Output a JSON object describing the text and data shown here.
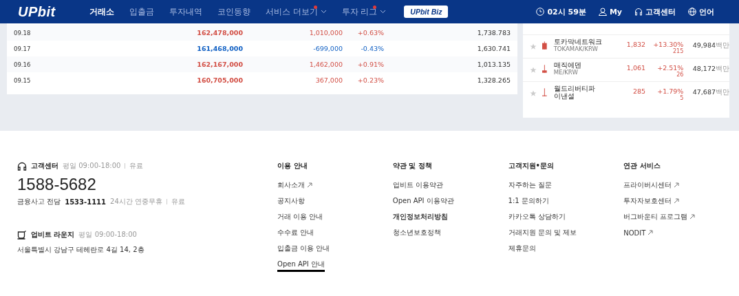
{
  "header": {
    "logo": "UPbit",
    "nav": [
      {
        "label": "거래소",
        "selected": true,
        "new": false,
        "dropdown": false
      },
      {
        "label": "입출금",
        "selected": false,
        "new": false,
        "dropdown": false
      },
      {
        "label": "투자내역",
        "selected": false,
        "new": false,
        "dropdown": false
      },
      {
        "label": "코인동향",
        "selected": false,
        "new": false,
        "dropdown": false
      },
      {
        "label": "서비스 더보기",
        "selected": false,
        "new": true,
        "dropdown": true
      },
      {
        "label": "투자 리그",
        "selected": false,
        "new": true,
        "dropdown": true
      }
    ],
    "biz_button": "UPbit Biz",
    "time": "02시 59분",
    "my": "My",
    "support": "고객센터",
    "language": "언어"
  },
  "daily_table": {
    "rows": [
      {
        "date": "09.18",
        "price": "162,478,000",
        "change": "1,010,000",
        "rate": "+0.63%",
        "volume": "1,738.783",
        "color": "#d24f45"
      },
      {
        "date": "09.17",
        "price": "161,468,000",
        "change": "-699,000",
        "rate": "-0.43%",
        "volume": "1,630.741",
        "color": "#1261c4"
      },
      {
        "date": "09.16",
        "price": "162,167,000",
        "change": "1,462,000",
        "rate": "+0.91%",
        "volume": "1,013.135",
        "color": "#d24f45"
      },
      {
        "date": "09.15",
        "price": "160,705,000",
        "change": "367,000",
        "rate": "+0.23%",
        "volume": "1,328.265",
        "color": "#d24f45"
      }
    ]
  },
  "coin_list": {
    "rows": [
      {
        "name": "토카막네트워크",
        "ticker": "TOKAMAK/KRW",
        "price": "1,832",
        "rate": "+13.30%",
        "change": "215",
        "volume": "49,984",
        "unit": "백만",
        "level": 0.8,
        "favorite": false
      },
      {
        "name": "매직에덴",
        "ticker": "ME/KRW",
        "price": "1,061",
        "rate": "+2.51%",
        "change": "26",
        "volume": "48,172",
        "unit": "백만",
        "level": 0.3,
        "favorite": false
      },
      {
        "name": "월드리버티파이낸셜",
        "price": "285",
        "rate": "+1.79%",
        "change": "5",
        "volume": "47,687",
        "unit": "백만",
        "level": 0.1,
        "favorite": false
      }
    ]
  },
  "footer": {
    "support": {
      "title": "고객센터",
      "hours": "평일 09:00-18:00",
      "fee": "유료",
      "phone": "1588-5682",
      "fraud_label": "금융사고 전담",
      "fraud_phone": "1533-1111",
      "fraud_hours": "24시간 연중무휴",
      "fraud_fee": "유료"
    },
    "lounge": {
      "title": "업비트 라운지",
      "hours": "평일 09:00-18:00",
      "address": "서울특별시 강남구 테헤란로 4길 14, 2층"
    },
    "columns": [
      {
        "title": "이용 안내",
        "links": [
          {
            "label": "회사소개",
            "external": true,
            "bold": false,
            "underlined": false
          },
          {
            "label": "공지사항",
            "external": false,
            "bold": false,
            "underlined": false
          },
          {
            "label": "거래 이용 안내",
            "external": false,
            "bold": false,
            "underlined": false
          },
          {
            "label": "수수료 안내",
            "external": false,
            "bold": false,
            "underlined": false
          },
          {
            "label": "입출금 이용 안내",
            "external": false,
            "bold": false,
            "underlined": false
          },
          {
            "label": "Open API 안내",
            "external": false,
            "bold": false,
            "underlined": true
          }
        ]
      },
      {
        "title": "약관 및 정책",
        "links": [
          {
            "label": "업비트 이용약관",
            "external": false,
            "bold": false,
            "underlined": false
          },
          {
            "label": "Open API 이용약관",
            "external": false,
            "bold": false,
            "underlined": false
          },
          {
            "label": "개인정보처리방침",
            "external": false,
            "bold": true,
            "underlined": false
          },
          {
            "label": "청소년보호정책",
            "external": false,
            "bold": false,
            "underlined": false
          }
        ]
      },
      {
        "title": "고객지원•문의",
        "links": [
          {
            "label": "자주하는 질문",
            "external": false,
            "bold": false,
            "underlined": false
          },
          {
            "label": "1:1 문의하기",
            "external": false,
            "bold": false,
            "underlined": false
          },
          {
            "label": "카카오톡 상담하기",
            "external": false,
            "bold": false,
            "underlined": false
          },
          {
            "label": "거래지원 문의 및 제보",
            "external": false,
            "bold": false,
            "underlined": false
          },
          {
            "label": "제휴문의",
            "external": false,
            "bold": false,
            "underlined": false
          }
        ]
      },
      {
        "title": "연관 서비스",
        "links": [
          {
            "label": "프라이버시센터",
            "external": true,
            "bold": false,
            "underlined": false
          },
          {
            "label": "투자자보호센터",
            "external": true,
            "bold": false,
            "underlined": false
          },
          {
            "label": "버그바운티 프로그램",
            "external": true,
            "bold": false,
            "underlined": false
          },
          {
            "label": "NODIT",
            "external": true,
            "bold": false,
            "underlined": false
          }
        ]
      }
    ]
  }
}
